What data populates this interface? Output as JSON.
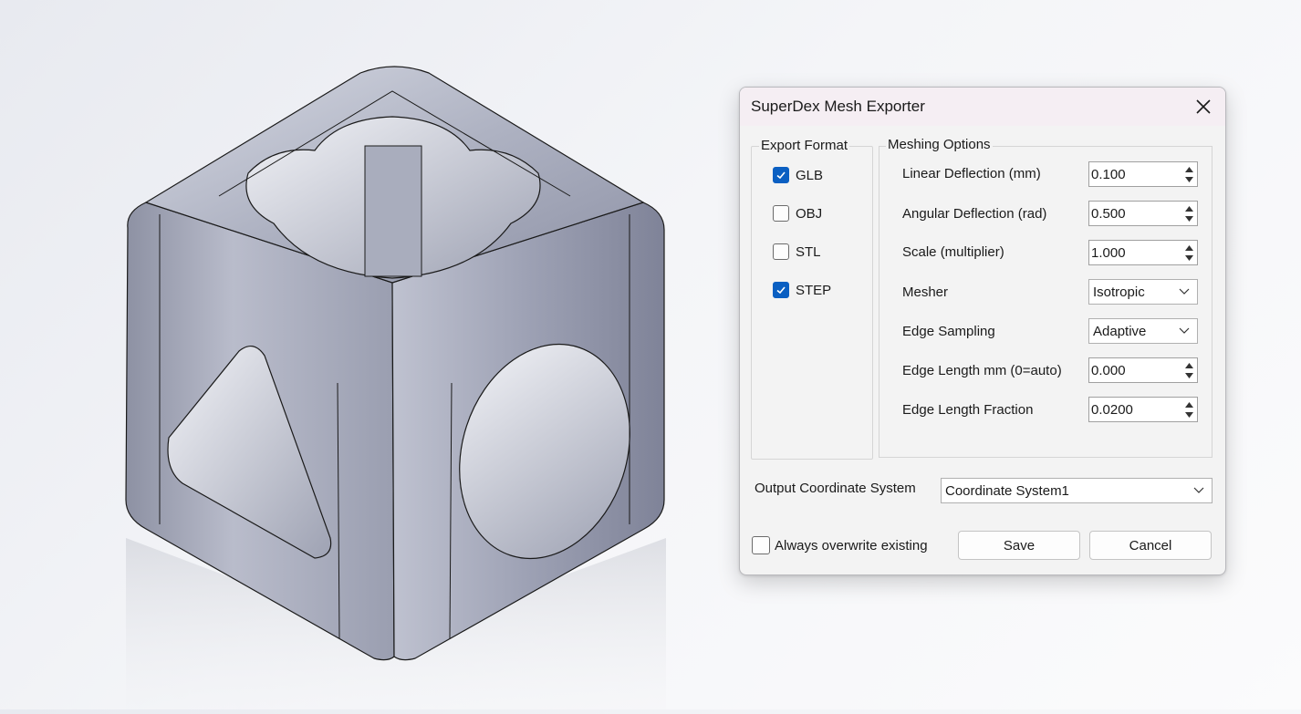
{
  "dialog": {
    "title": "SuperDex Mesh Exporter",
    "export_format": {
      "label": "Export Format",
      "items": [
        {
          "label": "GLB",
          "checked": true
        },
        {
          "label": "OBJ",
          "checked": false
        },
        {
          "label": "STL",
          "checked": false
        },
        {
          "label": "STEP",
          "checked": true
        }
      ]
    },
    "meshing_options": {
      "label": "Meshing Options",
      "linear_deflection": {
        "label": "Linear Deflection (mm)",
        "value": "0.100"
      },
      "angular_deflection": {
        "label": "Angular Deflection (rad)",
        "value": "0.500"
      },
      "scale": {
        "label": "Scale (multiplier)",
        "value": "1.000"
      },
      "mesher": {
        "label": "Mesher",
        "value": "Isotropic"
      },
      "edge_sampling": {
        "label": "Edge Sampling",
        "value": "Adaptive"
      },
      "edge_length": {
        "label": "Edge Length mm (0=auto)",
        "value": "0.000"
      },
      "edge_length_fraction": {
        "label": "Edge Length Fraction",
        "value": "0.0200"
      }
    },
    "output_coordinate_system": {
      "label": "Output Coordinate System",
      "value": "Coordinate System1"
    },
    "always_overwrite": {
      "label": "Always overwrite existing",
      "checked": false
    },
    "save_label": "Save",
    "cancel_label": "Cancel"
  },
  "colors": {
    "accent": "#0a5fc2",
    "titlebar": "#f5eef3",
    "dialog_bg": "#f3f3f3"
  },
  "icons": [
    "close-icon",
    "checkmark-icon",
    "spin-up-icon",
    "spin-down-icon",
    "chevron-down-icon"
  ]
}
